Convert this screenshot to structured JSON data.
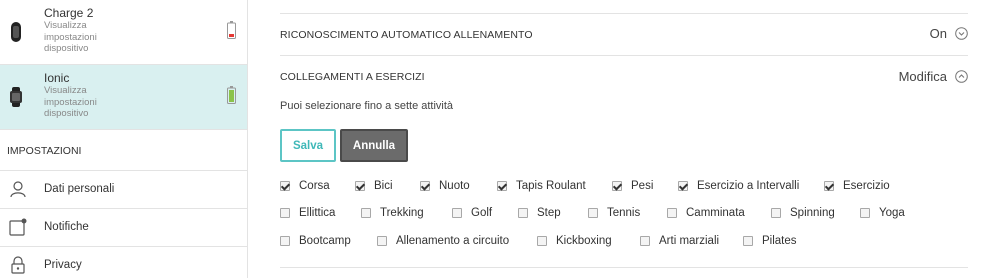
{
  "sidebar": {
    "devices": [
      {
        "name": "Charge 2",
        "subtitle": "Visualizza impostazioni dispositivo",
        "battery": "low",
        "battery_color": "#e53935"
      },
      {
        "name": "Ionic",
        "subtitle": "Visualizza impostazioni dispositivo",
        "battery": "full",
        "battery_color": "#8bc34a"
      }
    ],
    "settings_header": "IMPOSTAZIONI",
    "nav": [
      {
        "label": "Dati personali",
        "icon": "person-icon"
      },
      {
        "label": "Notifiche",
        "icon": "notification-icon"
      },
      {
        "label": "Privacy",
        "icon": "lock-icon"
      }
    ]
  },
  "main": {
    "auto_recognition": {
      "title": "RICONOSCIMENTO AUTOMATICO ALLENAMENTO",
      "value": "On"
    },
    "exercise_shortcuts": {
      "title": "COLLEGAMENTI A ESERCIZI",
      "action": "Modifica",
      "hint": "Puoi selezionare fino a sette attività",
      "save_label": "Salva",
      "cancel_label": "Annulla",
      "rows": [
        [
          {
            "label": "Corsa",
            "checked": true
          },
          {
            "label": "Bici",
            "checked": true
          },
          {
            "label": "Nuoto",
            "checked": true
          },
          {
            "label": "Tapis Roulant",
            "checked": true
          },
          {
            "label": "Pesi",
            "checked": true
          },
          {
            "label": "Esercizio a Intervalli",
            "checked": true
          },
          {
            "label": "Esercizio",
            "checked": true
          }
        ],
        [
          {
            "label": "Ellittica",
            "checked": false
          },
          {
            "label": "Trekking",
            "checked": false
          },
          {
            "label": "Golf",
            "checked": false
          },
          {
            "label": "Step",
            "checked": false
          },
          {
            "label": "Tennis",
            "checked": false
          },
          {
            "label": "Camminata",
            "checked": false
          },
          {
            "label": "Spinning",
            "checked": false
          },
          {
            "label": "Yoga",
            "checked": false
          }
        ],
        [
          {
            "label": "Bootcamp",
            "checked": false
          },
          {
            "label": "Allenamento a circuito",
            "checked": false
          },
          {
            "label": "Kickboxing",
            "checked": false
          },
          {
            "label": "Arti marziali",
            "checked": false
          },
          {
            "label": "Pilates",
            "checked": false
          }
        ]
      ]
    }
  },
  "colors": {
    "accent": "#3fb8b8",
    "active_bg": "#d9f0f0",
    "cancel_bg": "#6b6b6b"
  }
}
